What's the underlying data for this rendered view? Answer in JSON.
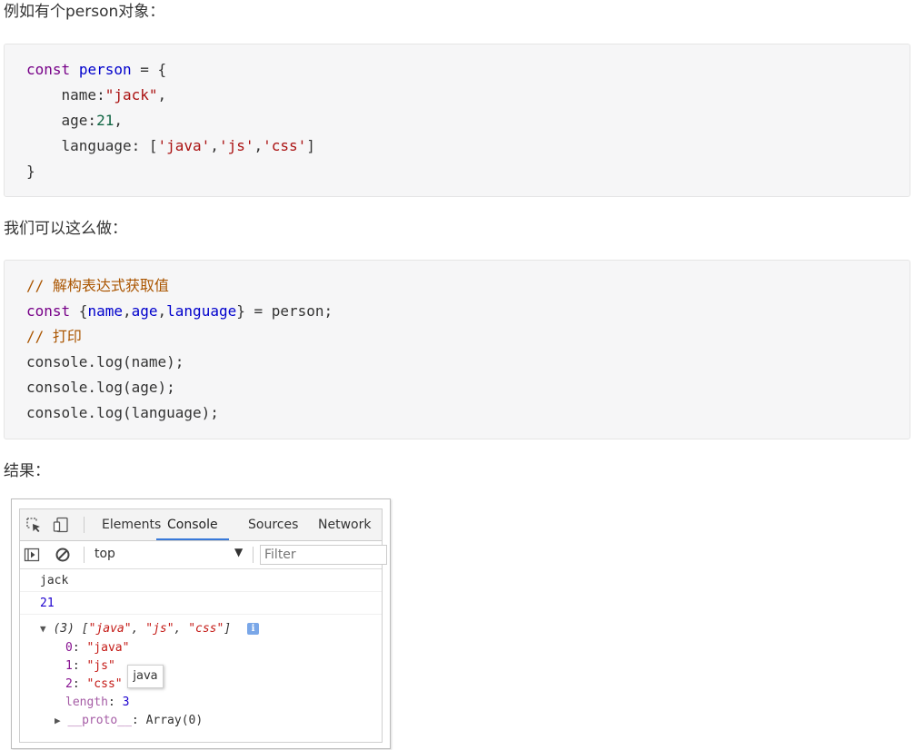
{
  "intro_text": "例如有个person对象：",
  "code1": {
    "line1": {
      "kw": "const",
      "var": "person",
      "rest": " = {"
    },
    "line2": {
      "key": "    name:",
      "val": "\"jack\"",
      "tail": ","
    },
    "line3": {
      "key": "    age:",
      "val": "21",
      "tail": ","
    },
    "line4": {
      "key": "    language: [",
      "v1": "'java'",
      "c1": ",",
      "v2": "'js'",
      "c2": ",",
      "v3": "'css'",
      "tail": "]"
    },
    "line5": "}"
  },
  "middle_text": "我们可以这么做：",
  "code2": {
    "comment1": "// 解构表达式获取值",
    "line2": {
      "kw": "const",
      "open": " {",
      "v1": "name",
      "c1": ",",
      "v2": "age",
      "c2": ",",
      "v3": "language",
      "tail": "} = person;"
    },
    "comment2": "// 打印",
    "line4": "console.log(name);",
    "line5": "console.log(age);",
    "line6": "console.log(language);"
  },
  "result_text": "结果：",
  "devtools": {
    "tabs": [
      "Elements",
      "Console",
      "Sources",
      "Network"
    ],
    "active_tab": "Console",
    "context": "top",
    "filter_placeholder": "Filter",
    "log1": "jack",
    "log2": "21",
    "array_summary": {
      "prefix": "(3) [",
      "v1": "\"java\"",
      "sep1": ", ",
      "v2": "\"js\"",
      "sep2": ", ",
      "v3": "\"css\"",
      "suffix": "]"
    },
    "items": [
      {
        "key": "0",
        "value": "\"java\""
      },
      {
        "key": "1",
        "value": "\"js\""
      },
      {
        "key": "2",
        "value": "\"css\""
      }
    ],
    "length_key": "length",
    "length_value": "3",
    "proto_key": "__proto__",
    "proto_value": "Array(0)",
    "tooltip": "java",
    "colors": {
      "accent": "#3879d9",
      "key": "#881391",
      "string": "#c41a16",
      "number": "#1c00cf"
    }
  }
}
